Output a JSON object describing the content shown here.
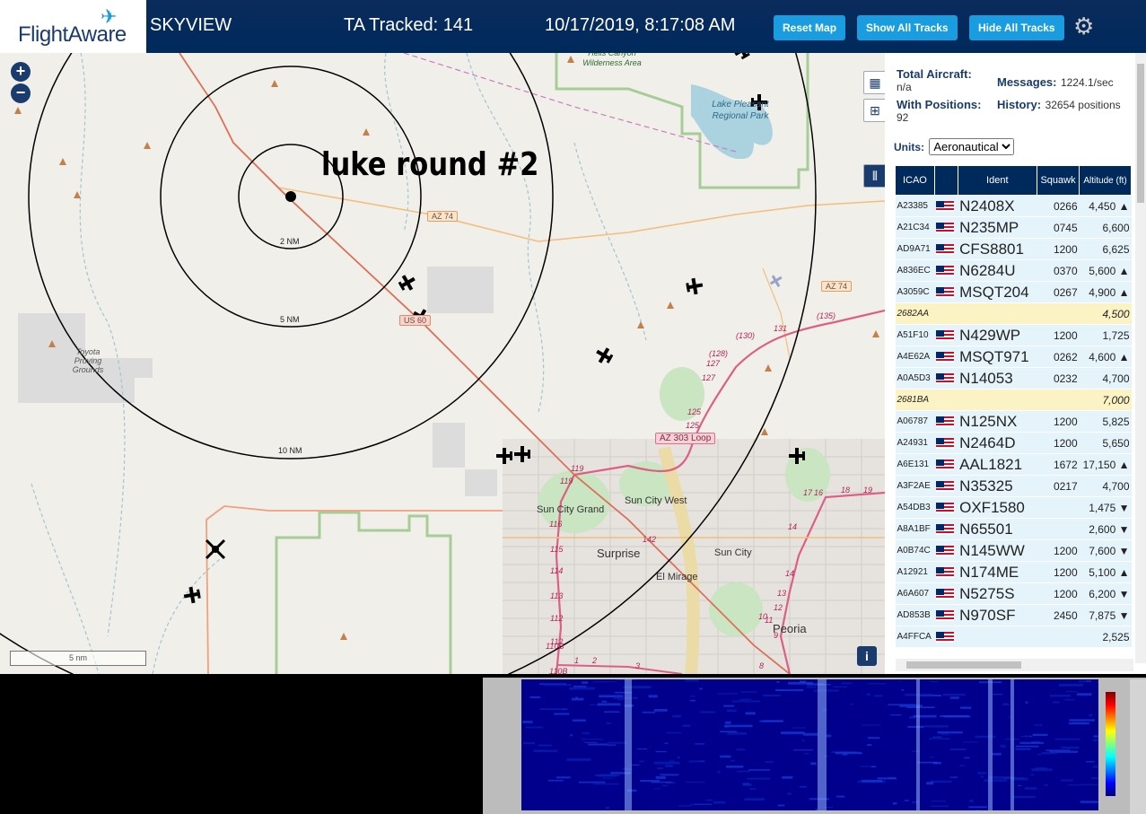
{
  "header": {
    "logo_text": "FlightAware",
    "app_title": "SKYVIEW",
    "tracked": "TA Tracked: 141",
    "datetime": "10/17/2019, 8:17:08 AM",
    "buttons": {
      "reset_map": "Reset Map",
      "show_all": "Show All Tracks",
      "hide_all": "Hide All Tracks"
    }
  },
  "map": {
    "overlay_text": "luke round #2",
    "range_rings": [
      "2 NM",
      "5 NM",
      "10 NM"
    ],
    "labels": {
      "wilderness": "Hells Canyon Wilderness Area",
      "lake": "Lake Pleasant Regional Park",
      "proving": "Toyota Proving Grounds",
      "sun_city_grand": "Sun City Grand",
      "sun_city_west": "Sun City West",
      "sun_city": "Sun City",
      "surprise": "Surprise",
      "el_mirage": "El Mirage",
      "peoria": "Peoria"
    },
    "shields": {
      "az74_a": "AZ 74",
      "az74_b": "AZ 74",
      "us60": "US 60",
      "az303": "AZ 303 Loop"
    },
    "route_numbers": [
      "(130)",
      "(135)",
      "131",
      "(128)",
      "127",
      "127",
      "125",
      "125",
      "119",
      "119",
      "116",
      "115",
      "114",
      "113",
      "112",
      "112",
      "110B",
      "110B",
      "142",
      "17",
      "16",
      "18",
      "19",
      "14",
      "14",
      "13",
      "12",
      "11",
      "10",
      "9",
      "8",
      "1",
      "2",
      "3"
    ],
    "scale_label": "5 nm",
    "zoom_in": "+",
    "zoom_out": "−",
    "info": "i"
  },
  "stats": {
    "total_aircraft_label": "Total Aircraft:",
    "total_aircraft_value": "n/a",
    "messages_label": "Messages:",
    "messages_value": "1224.1/sec",
    "with_positions_label": "With Positions:",
    "with_positions_value": "92",
    "history_label": "History:",
    "history_value": "32654 positions",
    "units_label": "Units:",
    "units_value": "Aeronautical"
  },
  "table": {
    "headers": {
      "icao": "ICAO",
      "ident": "Ident",
      "squawk": "Squawk",
      "altitude": "Altitude (ft)"
    },
    "rows": [
      {
        "icao": "A23385",
        "ident": "N2408X",
        "squawk": "0266",
        "alt": "4,450 ▲",
        "style": "r",
        "flag": true
      },
      {
        "icao": "A21C34",
        "ident": "N235MP",
        "squawk": "0745",
        "alt": "6,600",
        "style": "r",
        "flag": true
      },
      {
        "icao": "AD9A71",
        "ident": "CFS8801",
        "squawk": "1200",
        "alt": "6,625",
        "style": "r",
        "flag": true
      },
      {
        "icao": "A836EC",
        "ident": "N6284U",
        "squawk": "0370",
        "alt": "5,600 ▲",
        "style": "r",
        "flag": true
      },
      {
        "icao": "A3059C",
        "ident": "MSQT204",
        "squawk": "0267",
        "alt": "4,900 ▲",
        "style": "r",
        "flag": true
      },
      {
        "icao": "2682AA",
        "ident": "",
        "squawk": "",
        "alt": "4,500",
        "style": "y",
        "flag": false
      },
      {
        "icao": "A51F10",
        "ident": "N429WP",
        "squawk": "1200",
        "alt": "1,725",
        "style": "r",
        "flag": true
      },
      {
        "icao": "A4E62A",
        "ident": "MSQT971",
        "squawk": "0262",
        "alt": "4,600 ▲",
        "style": "r",
        "flag": true
      },
      {
        "icao": "A0A5D3",
        "ident": "N14053",
        "squawk": "0232",
        "alt": "4,700",
        "style": "r",
        "flag": true
      },
      {
        "icao": "2681BA",
        "ident": "",
        "squawk": "",
        "alt": "7,000",
        "style": "y",
        "flag": false
      },
      {
        "icao": "A06787",
        "ident": "N125NX",
        "squawk": "1200",
        "alt": "5,825",
        "style": "r",
        "flag": true
      },
      {
        "icao": "A24931",
        "ident": "N2464D",
        "squawk": "1200",
        "alt": "5,650",
        "style": "r",
        "flag": true
      },
      {
        "icao": "A6E131",
        "ident": "AAL1821",
        "squawk": "1672",
        "alt": "17,150 ▲",
        "style": "r",
        "flag": true
      },
      {
        "icao": "A3F2AE",
        "ident": "N35325",
        "squawk": "0217",
        "alt": "4,700",
        "style": "r",
        "flag": true
      },
      {
        "icao": "A54DB3",
        "ident": "OXF1580",
        "squawk": "",
        "alt": "1,475 ▼",
        "style": "r",
        "flag": true
      },
      {
        "icao": "A8A1BF",
        "ident": "N65501",
        "squawk": "",
        "alt": "2,600 ▼",
        "style": "r",
        "flag": true
      },
      {
        "icao": "A0B74C",
        "ident": "N145WW",
        "squawk": "1200",
        "alt": "7,600 ▼",
        "style": "r",
        "flag": true
      },
      {
        "icao": "A12921",
        "ident": "N174ME",
        "squawk": "1200",
        "alt": "5,100 ▲",
        "style": "r",
        "flag": true
      },
      {
        "icao": "A6A607",
        "ident": "N5275S",
        "squawk": "1200",
        "alt": "6,200 ▼",
        "style": "r",
        "flag": true
      },
      {
        "icao": "AD853B",
        "ident": "N970SF",
        "squawk": "2450",
        "alt": "7,875 ▼",
        "style": "r",
        "flag": true
      },
      {
        "icao": "A4FFCA",
        "ident": "",
        "squawk": "",
        "alt": "2,525",
        "style": "r",
        "flag": true
      }
    ]
  },
  "colors": {
    "header_bg": "#002a5c",
    "button_blue": "#1a9ce0",
    "row_blue": "#e5f4fb",
    "row_yellow": "#fcf3c4"
  },
  "icons": {
    "gear": "gear-icon",
    "map": "map-icon",
    "grid": "grid-icon",
    "columns": "columns-icon"
  }
}
